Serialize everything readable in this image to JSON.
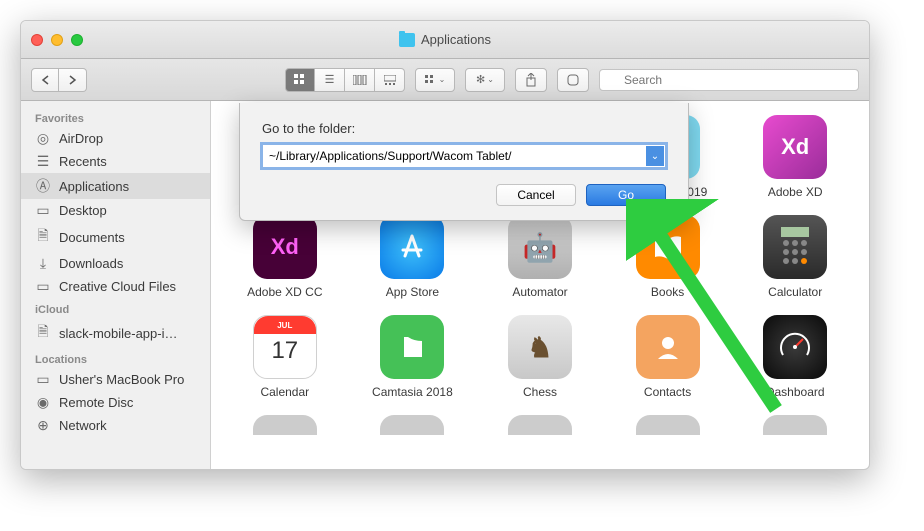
{
  "window": {
    "title": "Applications"
  },
  "toolbar": {
    "search_placeholder": "Search"
  },
  "sidebar": {
    "sections": [
      {
        "title": "Favorites",
        "items": [
          "AirDrop",
          "Recents",
          "Applications",
          "Desktop",
          "Documents",
          "Downloads",
          "Creative Cloud Files"
        ]
      },
      {
        "title": "iCloud",
        "items": [
          "slack-mobile-app-i…"
        ]
      },
      {
        "title": "Locations",
        "items": [
          "Usher's MacBook Pro",
          "Remote Disc",
          "Network"
        ]
      }
    ],
    "selected": "Applications"
  },
  "apps": {
    "row1": [
      "",
      "",
      "",
      "hotoshop 2019",
      "Adobe XD"
    ],
    "row2": [
      "Adobe XD CC",
      "App Store",
      "Automator",
      "Books",
      "Calculator"
    ],
    "row3": [
      "Calendar",
      "Camtasia 2018",
      "Chess",
      "Contacts",
      "Dashboard"
    ]
  },
  "calendar_icon": {
    "month": "JUL",
    "day": "17"
  },
  "dialog": {
    "label": "Go to the folder:",
    "value": "~/Library/Applications/Support/Wacom Tablet/",
    "cancel": "Cancel",
    "go": "Go"
  }
}
